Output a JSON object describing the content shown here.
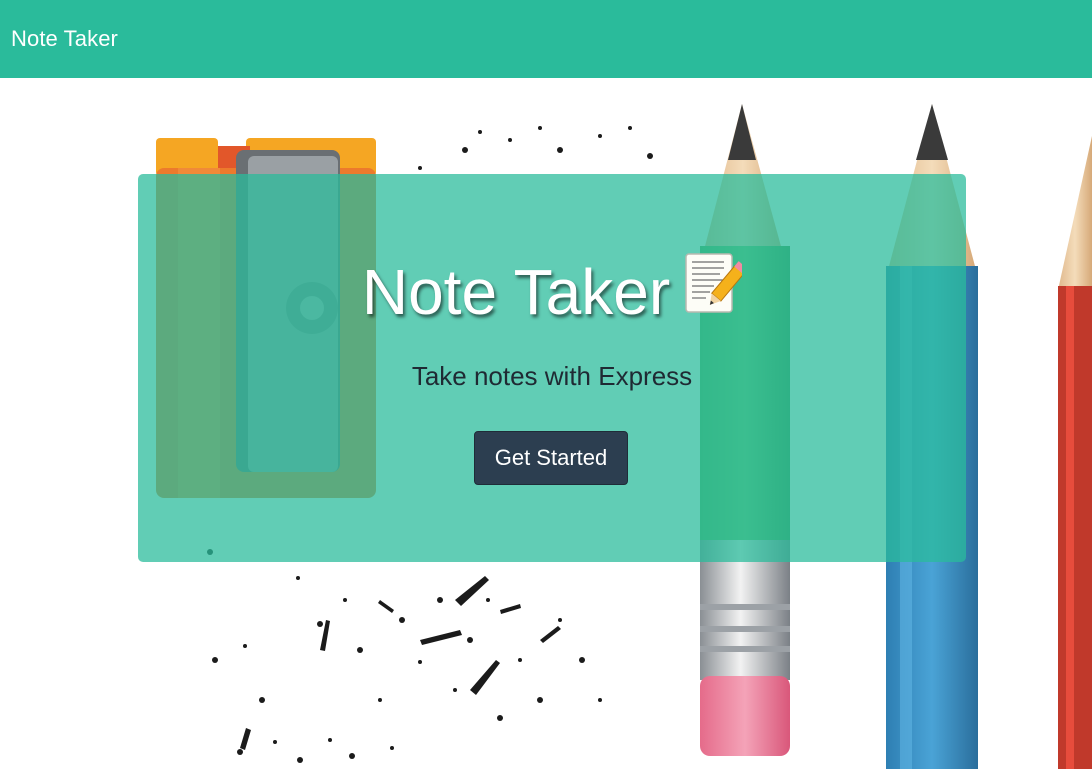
{
  "navbar": {
    "brand": "Note Taker"
  },
  "hero": {
    "title": "Note Taker",
    "title_icon": "memo-icon",
    "subtitle": "Take notes with Express",
    "cta_label": "Get Started"
  },
  "background": {
    "image_name": "pencils-and-sharpener-illustration"
  },
  "colors": {
    "accent": "#2abb9b",
    "button": "#2c3e50",
    "text_dark": "#1f2a33"
  }
}
